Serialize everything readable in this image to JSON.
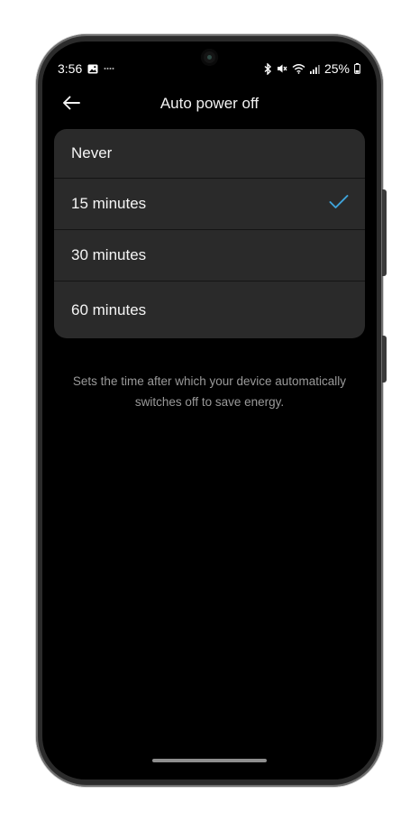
{
  "status_bar": {
    "time": "3:56",
    "battery": "25%",
    "icons": [
      "gallery-icon",
      "dots-icon",
      "bluetooth-icon",
      "mute-icon",
      "wifi-icon",
      "signal-icon",
      "battery-icon"
    ]
  },
  "header": {
    "title": "Auto power off",
    "back_icon": "back-arrow-icon"
  },
  "options": [
    {
      "label": "Never",
      "selected": false
    },
    {
      "label": "15 minutes",
      "selected": true
    },
    {
      "label": "30 minutes",
      "selected": false
    },
    {
      "label": "60 minutes",
      "selected": false
    }
  ],
  "description": "Sets the time after which your device automatically switches off to save energy.",
  "colors": {
    "accent": "#3fa3d9",
    "card": "#2a2a2a",
    "background": "#000000"
  }
}
